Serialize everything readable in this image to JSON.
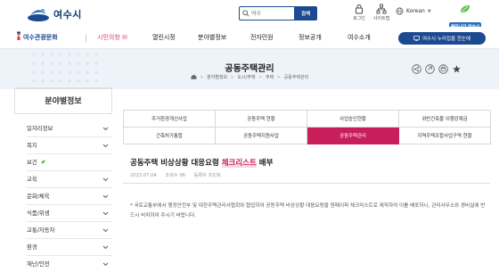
{
  "header": {
    "logo_text": "여수시",
    "search_placeholder": "여수",
    "search_button": "검색",
    "login_label": "로그인",
    "sitemap_label": "사이트맵",
    "language": "Korean",
    "clean_badge": "클린나라 여수시"
  },
  "nav": {
    "items": [
      {
        "label": "여수관광문화",
        "icon": "lighthouse-icon"
      },
      {
        "label": "시민의창 ✉",
        "icon": ""
      },
      {
        "label": "열린시정"
      },
      {
        "label": "분야별정보"
      },
      {
        "label": "전자민원"
      },
      {
        "label": "정보공개"
      },
      {
        "label": "여수소개"
      }
    ],
    "cta": "여수시 누리집을 한눈에"
  },
  "banner": {
    "title": "공동주택관리",
    "breadcrumb": [
      "분야별정보",
      "도시/주택",
      "주택",
      "공동주택관리"
    ]
  },
  "sidebar": {
    "title": "분야별정보",
    "items": [
      {
        "label": "일자리정보",
        "expand": true
      },
      {
        "label": "복지",
        "expand": true
      },
      {
        "label": "보건",
        "leaf": true,
        "expand": false
      },
      {
        "label": "교육",
        "expand": true
      },
      {
        "label": "문화/체육",
        "expand": true
      },
      {
        "label": "식품/위생",
        "expand": true
      },
      {
        "label": "교통/자동차",
        "expand": true
      },
      {
        "label": "환경",
        "expand": true
      },
      {
        "label": "재난/안전",
        "expand": true
      }
    ]
  },
  "tabs": [
    {
      "label": "주거환경개선사업",
      "active": false
    },
    {
      "label": "공동주택 현황",
      "active": false
    },
    {
      "label": "사업승인현황",
      "active": false
    },
    {
      "label": "위반건축물 이행강제금",
      "active": false
    },
    {
      "label": "건축허가통합",
      "active": false
    },
    {
      "label": "공동주택지원사업",
      "active": false
    },
    {
      "label": "공동주택관리",
      "active": true
    },
    {
      "label": "지역주택조합사업구역 현황",
      "active": false
    }
  ],
  "article": {
    "title_pre": "공동주택 비상상황 대응요령 ",
    "title_hl": "체크리스트",
    "title_post": " 배부",
    "date": "2023.07.04",
    "views": "조회수 96",
    "author": "등록자 조민호",
    "body": "* 국토교통부에서 행정안전부 및 대한주택관리사협회와 협업하여 공동주택 비상상황 대응요령을 원페이퍼 체크리스트로 제작하여 이를 배포하니, 관리사무소와 경비실에 반드시 비치하여 주시기 바랍니다."
  },
  "colors": {
    "brand_blue": "#1c4a91",
    "accent_pink": "#c81e5a",
    "banner_bg": "#eef3f9"
  }
}
